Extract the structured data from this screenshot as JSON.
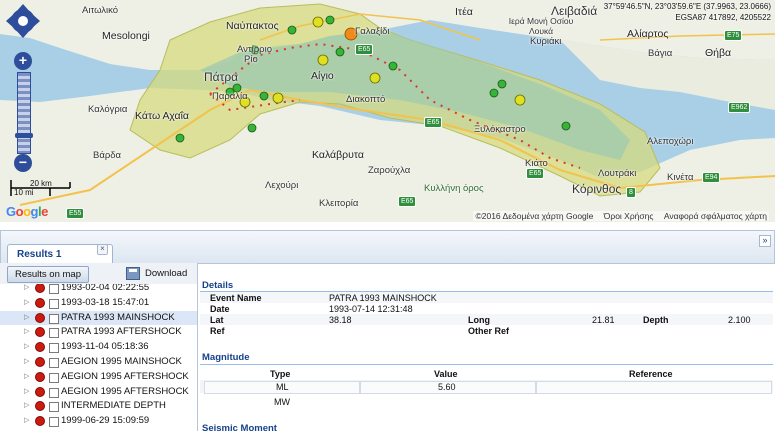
{
  "map": {
    "coords_line1": "37°59'46.5\"N, 23°03'59.6\"E (37.9963, 23.0666)",
    "coords_line2": "EGSA87 417892, 4205522",
    "scale_km": "20 km",
    "scale_mi": "10 mi",
    "attribution": "©2016 Δεδομένα χάρτη Google",
    "terms": "Όροι Χρήσης",
    "report": "Αναφορά σφάλματος χάρτη",
    "logo": "Google",
    "labels": [
      {
        "text": "Αιτωλικό"
      },
      {
        "text": "Mesolongi"
      },
      {
        "text": "Ναύπακτος"
      },
      {
        "text": "Αντίρριο"
      },
      {
        "text": "Ρίο"
      },
      {
        "text": "Πάτρα"
      },
      {
        "text": "Παραλία"
      },
      {
        "text": "Καλόγρια"
      },
      {
        "text": "Κάτω Αχαΐα"
      },
      {
        "text": "Βάρδα"
      },
      {
        "text": "Γαλαξίδι"
      },
      {
        "text": "Ιτέα"
      },
      {
        "text": "Λειβαδιά"
      },
      {
        "text": "Ιερά Μονή Οσίου Λουκά"
      },
      {
        "text": "Κυριάκι"
      },
      {
        "text": "Αλίαρτος"
      },
      {
        "text": "Θήβα"
      },
      {
        "text": "Βάγια"
      },
      {
        "text": "Αίγιο"
      },
      {
        "text": "Διακοπτό"
      },
      {
        "text": "Ξυλόκαστρο"
      },
      {
        "text": "Καλάβρυτα"
      },
      {
        "text": "Ζαρούχλα"
      },
      {
        "text": "Λεχούρι"
      },
      {
        "text": "Κλειτορία"
      },
      {
        "text": "Κυλλήνη όρος"
      },
      {
        "text": "Κιάτο"
      },
      {
        "text": "Κόρινθος"
      },
      {
        "text": "Λουτράκι"
      },
      {
        "text": "Κινέτα"
      },
      {
        "text": "Αλεποχώρι"
      }
    ],
    "roads": [
      "E65",
      "E65",
      "E65",
      "E65",
      "E75",
      "E962",
      "E94",
      "E55",
      "8"
    ]
  },
  "results": {
    "tab_label": "Results 1",
    "tab_close": "×",
    "collapse": "»",
    "btn_results_on_map": "Results on map",
    "btn_download": "Download",
    "events": [
      {
        "label": "1993-02-04 02:22:55",
        "selected": false
      },
      {
        "label": "1993-03-18 15:47:01",
        "selected": false
      },
      {
        "label": "PATRA 1993 MAINSHOCK",
        "selected": true
      },
      {
        "label": "PATRA 1993 AFTERSHOCK",
        "selected": false
      },
      {
        "label": "1993-11-04 05:18:36",
        "selected": false
      },
      {
        "label": "AEGION 1995 MAINSHOCK",
        "selected": false
      },
      {
        "label": "AEGION 1995 AFTERSHOCK",
        "selected": false
      },
      {
        "label": "AEGION 1995 AFTERSHOCK",
        "selected": false
      },
      {
        "label": "INTERMEDIATE DEPTH",
        "selected": false
      },
      {
        "label": "1999-06-29 15:09:59",
        "selected": false
      }
    ],
    "event_color": "#cc1a10"
  },
  "details": {
    "section_title": "Details",
    "event_name_label": "Event Name",
    "event_name": "PATRA 1993 MAINSHOCK",
    "date_label": "Date",
    "date": "1993-07-14 12:31:48",
    "lat_label": "Lat",
    "lat": "38.18",
    "long_label": "Long",
    "long": "21.81",
    "depth_label": "Depth",
    "depth": "2.100",
    "ref_label": "Ref",
    "other_ref_label": "Other Ref"
  },
  "magnitude": {
    "section_title": "Magnitude",
    "col_type": "Type",
    "col_value": "Value",
    "col_reference": "Reference",
    "rows": [
      {
        "type": "ML",
        "value": "5.60",
        "reference": ""
      },
      {
        "type": "MW",
        "value": "",
        "reference": ""
      }
    ]
  },
  "seismic_moment": {
    "section_title": "Seismic Moment"
  }
}
